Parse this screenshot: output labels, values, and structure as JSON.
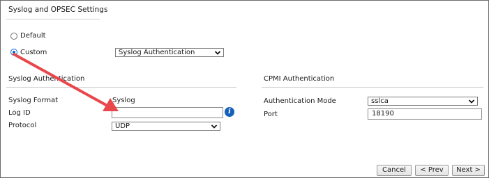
{
  "section": {
    "title": "Syslog and OPSEC Settings"
  },
  "mode": {
    "default_label": "Default",
    "custom_label": "Custom",
    "selected": "custom",
    "custom_select_value": "Syslog Authentication"
  },
  "syslog": {
    "heading": "Syslog Authentication",
    "format_label": "Syslog Format",
    "format_value": "Syslog",
    "log_id_label": "Log ID",
    "log_id_value": "",
    "protocol_label": "Protocol",
    "protocol_value": "UDP"
  },
  "cpmi": {
    "heading": "CPMI Authentication",
    "auth_mode_label": "Authentication Mode",
    "auth_mode_value": "sslca",
    "port_label": "Port",
    "port_value": "18190"
  },
  "icons": {
    "info": "info-icon",
    "info_glyph": "i",
    "chevron": "chevron-down-icon",
    "annotation": "red-arrow-icon"
  },
  "footer": {
    "cancel_label": "Cancel",
    "prev_label": "< Prev",
    "next_label": "Next >"
  },
  "colors": {
    "annotation_arrow": "#e8474b",
    "radio_selected": "#0a64d6",
    "info_icon": "#1560b8"
  }
}
